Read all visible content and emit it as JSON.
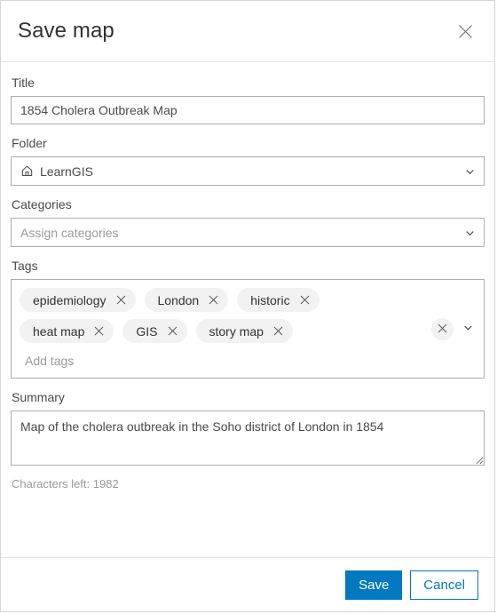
{
  "dialog": {
    "title": "Save map",
    "close_icon": "close-icon"
  },
  "title_field": {
    "label": "Title",
    "value": "1854 Cholera Outbreak Map",
    "placeholder": "Title"
  },
  "folder_field": {
    "label": "Folder",
    "value": "LearnGIS",
    "icon": "home-icon",
    "chevron": "chevron-down-icon"
  },
  "categories_field": {
    "label": "Categories",
    "value": "",
    "placeholder": "Assign categories",
    "chevron": "chevron-down-icon"
  },
  "tags_field": {
    "label": "Tags",
    "tags": [
      "epidemiology",
      "London",
      "historic",
      "heat map",
      "GIS",
      "story map"
    ],
    "input_placeholder": "Add tags",
    "clear_icon": "close-icon",
    "chevron": "chevron-down-icon"
  },
  "summary_field": {
    "label": "Summary",
    "value": "Map of the cholera outbreak in the Soho district of London in 1854",
    "placeholder": "Summary",
    "characters_left": "Characters left: 1982"
  },
  "footer": {
    "save_label": "Save",
    "cancel_label": "Cancel"
  },
  "colors": {
    "accent": "#0079c1",
    "border": "#aeaeae",
    "chip_bg": "#f2f2f2",
    "text": "#4a4a4a",
    "placeholder": "#9a9a9a"
  }
}
